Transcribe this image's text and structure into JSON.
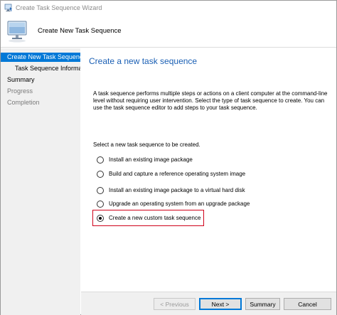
{
  "window": {
    "title": "Create Task Sequence Wizard",
    "icon": "wizard-computer-icon"
  },
  "header": {
    "title": "Create New Task Sequence",
    "icon": "computer-monitor-icon"
  },
  "sidebar": {
    "items": [
      {
        "label": "Create New Task Sequence",
        "state": "active"
      },
      {
        "label": "Task Sequence Information",
        "state": "sub"
      },
      {
        "label": "Summary",
        "state": "normal"
      },
      {
        "label": "Progress",
        "state": "dim"
      },
      {
        "label": "Completion",
        "state": "dim"
      }
    ]
  },
  "main": {
    "page_title": "Create a new task sequence",
    "description": "A task sequence performs multiple steps or actions on a client computer at the command-line level without requiring user intervention. Select the type of task sequence to create. You can use the task sequence editor to add steps to your task sequence.",
    "prompt": "Select a new task sequence to be created.",
    "options": [
      {
        "label": "Install an existing image package",
        "checked": false
      },
      {
        "label": "Build and capture a reference operating system image",
        "checked": false
      },
      {
        "label": "Install an existing image package to a virtual hard disk",
        "checked": false
      },
      {
        "label": "Upgrade an operating system from an upgrade package",
        "checked": false
      },
      {
        "label": "Create a new custom task sequence",
        "checked": true
      }
    ]
  },
  "footer": {
    "previous_label": "< Previous",
    "next_label": "Next >",
    "summary_label": "Summary",
    "cancel_label": "Cancel"
  },
  "colors": {
    "accent": "#0078d7",
    "title_blue": "#1a5fb4",
    "highlight_red": "#d0021b"
  }
}
